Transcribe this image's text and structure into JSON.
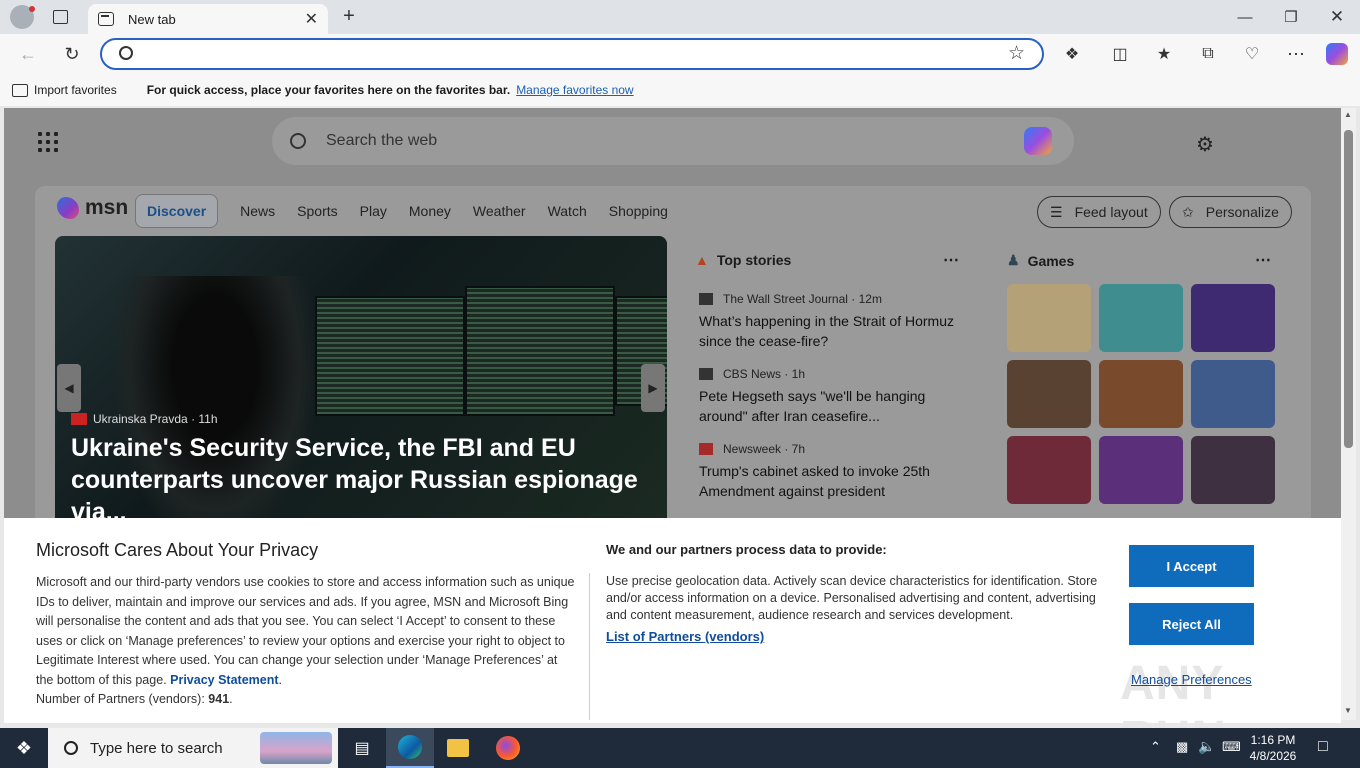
{
  "browser": {
    "tab_title": "New tab",
    "tab_close": "✕",
    "new_tab": "+",
    "address_value": "",
    "favbar": {
      "import": "Import favorites",
      "message": "For quick access, place your favorites here on the favorites bar.",
      "manage_link": "Manage favorites now"
    }
  },
  "newtab": {
    "search_placeholder": "Search the web",
    "msn_logo": "msn",
    "nav": [
      "Discover",
      "News",
      "Sports",
      "Play",
      "Money",
      "Weather",
      "Watch",
      "Shopping"
    ],
    "feed_layout": "Feed layout",
    "personalize": "Personalize",
    "hero": {
      "source": "Ukrainska Pravda",
      "age": "· 11h",
      "headline": "Ukraine's Security Service, the FBI and EU counterparts uncover major Russian espionage via..."
    },
    "top_stories": {
      "title": "Top stories",
      "items": [
        {
          "source": "The Wall Street Journal · 12m",
          "headline": "What’s happening in the Strait of Hormuz since the cease-fire?"
        },
        {
          "source": "CBS News · 1h",
          "headline": "Pete Hegseth says \"we'll be hanging around\" after Iran ceasefire..."
        },
        {
          "source": "Newsweek · 7h",
          "headline": "Trump's cabinet asked to invoke 25th Amendment against president"
        }
      ]
    },
    "games": {
      "title": "Games"
    }
  },
  "privacy": {
    "title": "Microsoft Cares About Your Privacy",
    "body": "Microsoft and our third-party vendors use cookies to store and access information such as unique IDs to deliver, maintain and improve our services and ads. If you agree, MSN and Microsoft Bing will personalise the content and ads that you see. You can select ‘I Accept’ to consent to these uses or click on ‘Manage preferences’ to review your options and exercise your right to object to Legitimate Interest where used. You can change your selection under ‘Manage Preferences’ at the bottom of this page.",
    "privacy_link": "Privacy Statement",
    "partners_label": "Number of Partners (vendors):",
    "partners_count": "941",
    "right_title": "We and our partners process data to provide:",
    "right_body": "Use precise geolocation data. Actively scan device characteristics for identification. Store and/or access information on a device. Personalised advertising and content, advertising and content measurement, audience research and services development.",
    "partners_link": "List of Partners (vendors)",
    "accept": "I Accept",
    "reject": "Reject All",
    "manage": "Manage Preferences"
  },
  "watermark": "ANY RUN",
  "taskbar": {
    "search_placeholder": "Type here to search",
    "time": "1:16 PM",
    "date": "4/8/2026"
  },
  "colors": {
    "accent": "#0f6cbd",
    "address_border": "#2860c6",
    "taskbar": "#1f2b3a"
  }
}
